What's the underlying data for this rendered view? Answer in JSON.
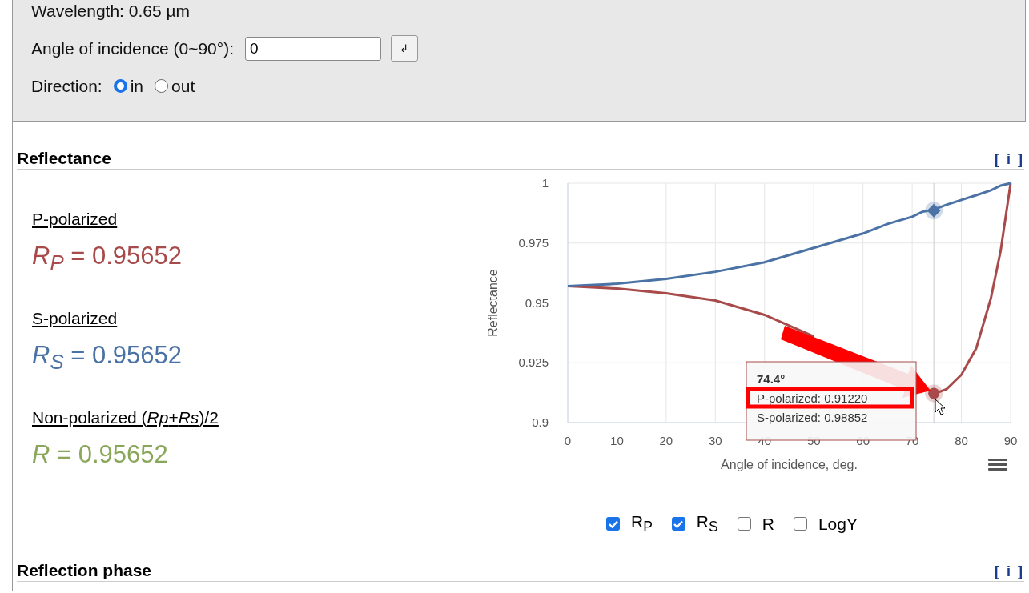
{
  "settings": {
    "wavelength": "Wavelength: 0.65 µm",
    "angle_label": "Angle of incidence (0~90°):",
    "angle_value": "0",
    "enter_button": "↲",
    "direction_label": "Direction:",
    "directions": [
      {
        "label": "in",
        "selected": true
      },
      {
        "label": "out",
        "selected": false
      }
    ]
  },
  "reflectance": {
    "title": "Reflectance",
    "info_link": "[ i ]",
    "results": [
      {
        "label": "P-polarized",
        "formula": "*R$_{P}$* = 0.95652",
        "color": "#a84a4a"
      },
      {
        "label": "S-polarized",
        "formula": "*R$_{S}$* = 0.95652",
        "color": "#4a72a4"
      },
      {
        "label": "Non-polarized (*Rp*+*Rs*)/2",
        "formula": "*R* = 0.95652",
        "color": "#8aa65a"
      }
    ],
    "chart_data": {
      "type": "line",
      "xlabel": "Angle of incidence, deg.",
      "ylabel": "Reflectance",
      "grid": true,
      "ref_lines": [
        {
          "axis": "x",
          "value": 74.4,
          "color": "#cccccc"
        }
      ],
      "x": [
        0,
        10,
        20,
        30,
        40,
        50,
        60,
        65,
        70,
        72,
        74.4,
        77,
        80,
        83,
        86,
        88,
        90
      ],
      "series": [
        {
          "color": "#a84a4a",
          "values": [
            0.957,
            0.956,
            0.954,
            0.951,
            0.945,
            0.936,
            null,
            null,
            null,
            null,
            0.912,
            0.914,
            0.92,
            0.931,
            0.952,
            0.972,
            1
          ]
        },
        {
          "color": "#4a72a4",
          "values": [
            0.957,
            0.958,
            0.96,
            0.963,
            0.967,
            0.973,
            0.979,
            0.983,
            0.986,
            0.988,
            0.989,
            0.991,
            0.993,
            0.995,
            0.997,
            0.999,
            1
          ]
        }
      ],
      "xlim": [
        0,
        90
      ],
      "ylim": [
        0.9,
        1
      ],
      "xticks": [
        0,
        10,
        20,
        30,
        40,
        50,
        60,
        70,
        80,
        90
      ],
      "yticks": [
        {
          "value": 0.9,
          "label": "0.9"
        },
        {
          "value": 0.925,
          "label": "0.925"
        },
        {
          "value": 0.95,
          "label": "0.95"
        },
        {
          "value": 0.975,
          "label": "0.975"
        },
        {
          "value": 1,
          "label": "1"
        }
      ]
    },
    "tooltip": {
      "title": "74.4°",
      "lines": [
        {
          "text": "P-polarized: 0.91220",
          "highlighted": true
        },
        {
          "text": "S-polarized: 0.98852",
          "highlighted": false
        }
      ]
    },
    "toggles": [
      {
        "label": "R$_{P}$",
        "checked": true
      },
      {
        "label": "R$_{S}$",
        "checked": true
      },
      {
        "label": "R",
        "checked": false
      },
      {
        "label": "LogY",
        "checked": false
      }
    ]
  },
  "phase": {
    "title": "Reflection phase",
    "info_link": "[ i ]"
  }
}
